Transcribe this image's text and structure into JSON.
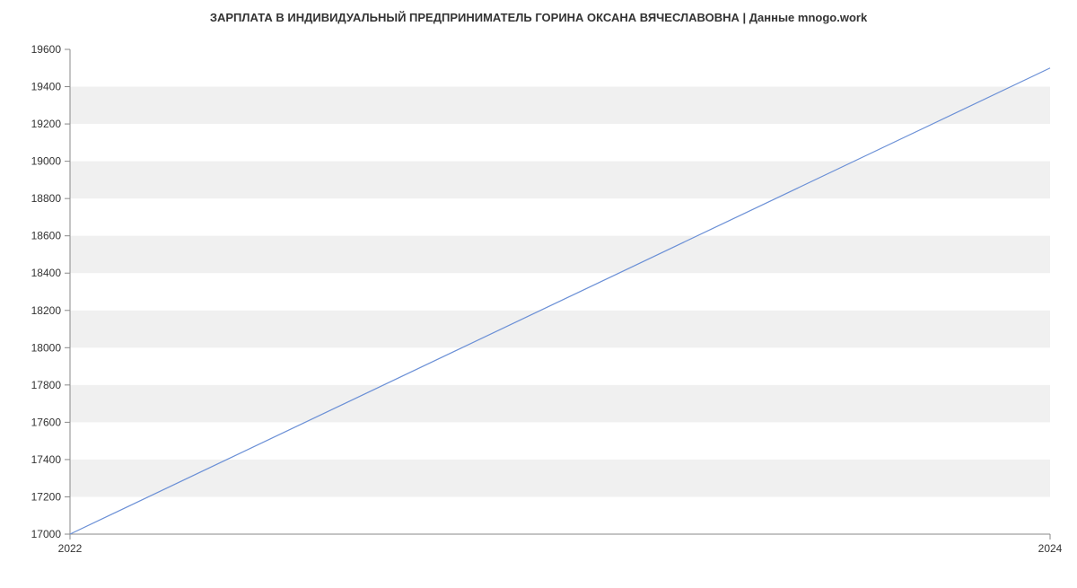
{
  "chart_data": {
    "type": "line",
    "title": "ЗАРПЛАТА В ИНДИВИДУАЛЬНЫЙ ПРЕДПРИНИМАТЕЛЬ ГОРИНА ОКСАНА ВЯЧЕСЛАВОВНА | Данные mnogo.work",
    "xlabel": "",
    "ylabel": "",
    "x": [
      2022,
      2024
    ],
    "values": [
      17000,
      19500
    ],
    "xlim": [
      2022,
      2024
    ],
    "ylim": [
      17000,
      19600
    ],
    "yticks": [
      17000,
      17200,
      17400,
      17600,
      17800,
      18000,
      18200,
      18400,
      18600,
      18800,
      19000,
      19200,
      19400,
      19600
    ],
    "xticks": [
      2022,
      2024
    ]
  }
}
